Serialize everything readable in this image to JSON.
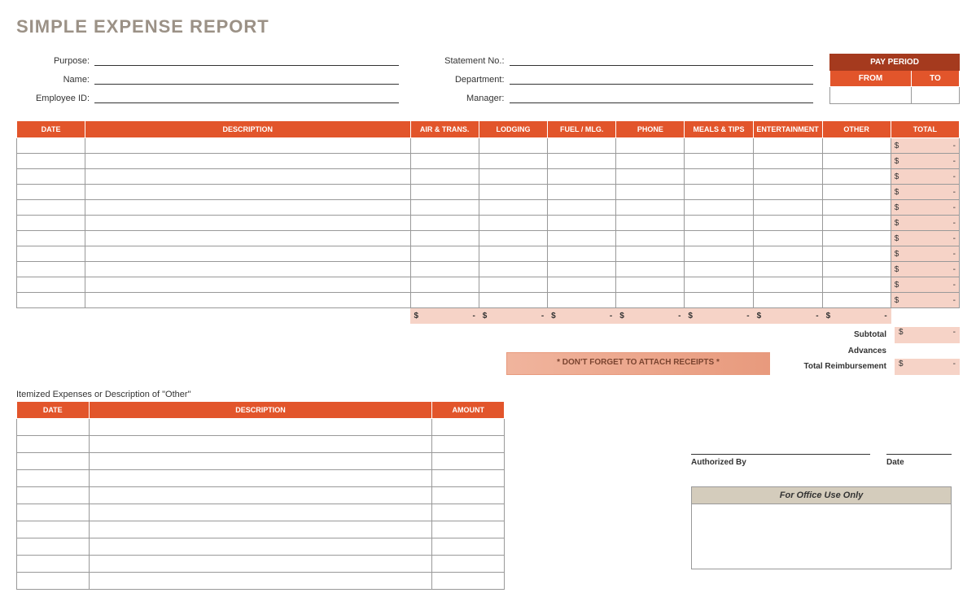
{
  "title": "SIMPLE EXPENSE REPORT",
  "header": {
    "left": [
      {
        "label": "Purpose:",
        "value": ""
      },
      {
        "label": "Name:",
        "value": ""
      },
      {
        "label": "Employee ID:",
        "value": ""
      }
    ],
    "right": [
      {
        "label": "Statement No.:",
        "value": ""
      },
      {
        "label": "Department:",
        "value": ""
      },
      {
        "label": "Manager:",
        "value": ""
      }
    ]
  },
  "pay_period": {
    "title": "PAY PERIOD",
    "from_label": "FROM",
    "to_label": "TO",
    "from": "",
    "to": ""
  },
  "main_table": {
    "headers": [
      "DATE",
      "DESCRIPTION",
      "AIR & TRANS.",
      "LODGING",
      "FUEL / MLG.",
      "PHONE",
      "MEALS & TIPS",
      "ENTERTAINMENT",
      "OTHER",
      "TOTAL"
    ],
    "rows": 11,
    "row_total": {
      "symbol": "$",
      "value": "-"
    },
    "column_totals": {
      "symbol": "$",
      "value": "-"
    }
  },
  "subtotals": {
    "subtotal_label": "Subtotal",
    "subtotal": {
      "symbol": "$",
      "value": "-"
    },
    "advances_label": "Advances",
    "advances": "",
    "total_label": "Total Reimbursement",
    "total": {
      "symbol": "$",
      "value": "-"
    }
  },
  "reminder": "* DON'T FORGET TO ATTACH RECEIPTS *",
  "itemized": {
    "title": "Itemized Expenses or Description of \"Other\"",
    "headers": [
      "DATE",
      "DESCRIPTION",
      "AMOUNT"
    ],
    "rows": 10
  },
  "signatures": {
    "auth_label": "Authorized By",
    "date_label": "Date",
    "office_label": "For Office Use Only"
  }
}
